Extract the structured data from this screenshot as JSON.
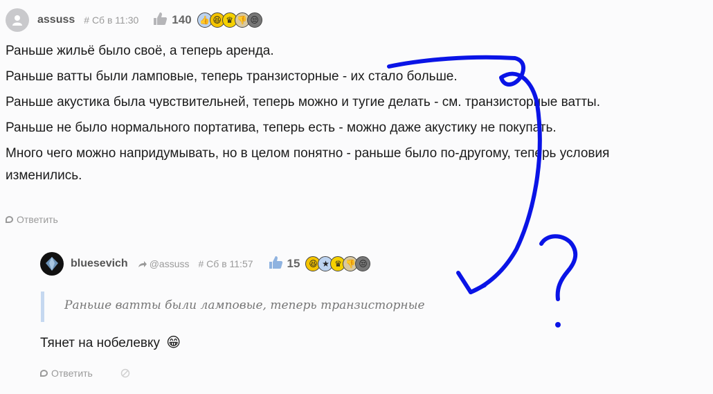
{
  "comment": {
    "author": "assuss",
    "timestamp": "# Сб в 11:30",
    "likes": "140",
    "reactions": [
      "thumbs-up",
      "laughing",
      "crown",
      "thumbs-down",
      "annoyed"
    ],
    "lines": [
      "Раньше жильё было своё, а теперь аренда.",
      "Раньше ватты были ламповые, теперь транзисторные - их стало больше.",
      "Раньше акустика была чувствительней, теперь можно и тугие делать - см. транзисторные ватты.",
      "Раньше не было нормального портатива, теперь есть - можно даже акустику не покупать.",
      "Много чего можно напридумывать, но в целом понятно - раньше было по-другому, теперь условия",
      "изменились."
    ],
    "reply_label": "Ответить"
  },
  "reply": {
    "author": "bluesevich",
    "reply_to": "@assuss",
    "timestamp": "# Сб в 11:57",
    "likes": "15",
    "reactions": [
      "laughing",
      "star",
      "crown",
      "thumbs-down",
      "annoyed"
    ],
    "quote": "Раньше ватты были ламповые, теперь транзисторные",
    "text": "Тянет на нобелевку",
    "emoji": "😁",
    "reply_label": "Ответить"
  },
  "annotation": {
    "mark": "?",
    "color": "#0a14e6"
  }
}
